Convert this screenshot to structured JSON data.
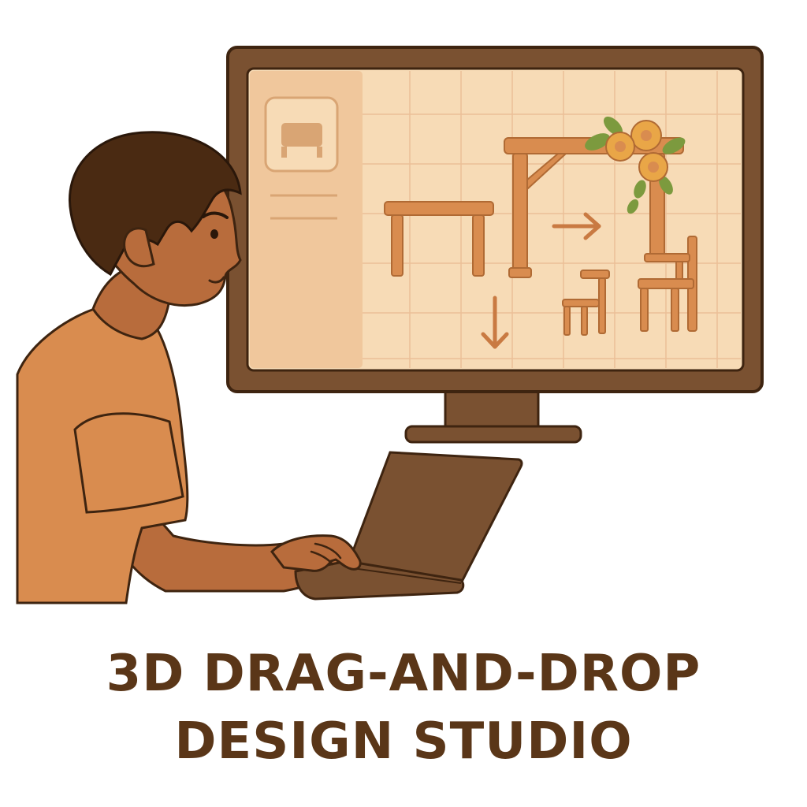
{
  "caption": {
    "line1": "3D DRAG-AND-DROP",
    "line2": "DESIGN STUDIO"
  },
  "colors": {
    "text": "#5a3618",
    "monitor_frame": "#7a5131",
    "screen_bg": "#f7dbb6",
    "sidebar_bg": "#f0c79c",
    "furniture": "#d98c4f",
    "grid": "#e8b98f",
    "skin": "#b86c3c",
    "hair": "#4a2a12",
    "shirt": "#d98c4f",
    "flowers": "#e9a647",
    "leaves": "#7c9a3e",
    "laptop": "#7a5131"
  },
  "icons": {
    "sidebar": "table-thumbnail-icon",
    "arrow_right": "arrow-right-icon",
    "arrow_down": "arrow-down-icon"
  }
}
